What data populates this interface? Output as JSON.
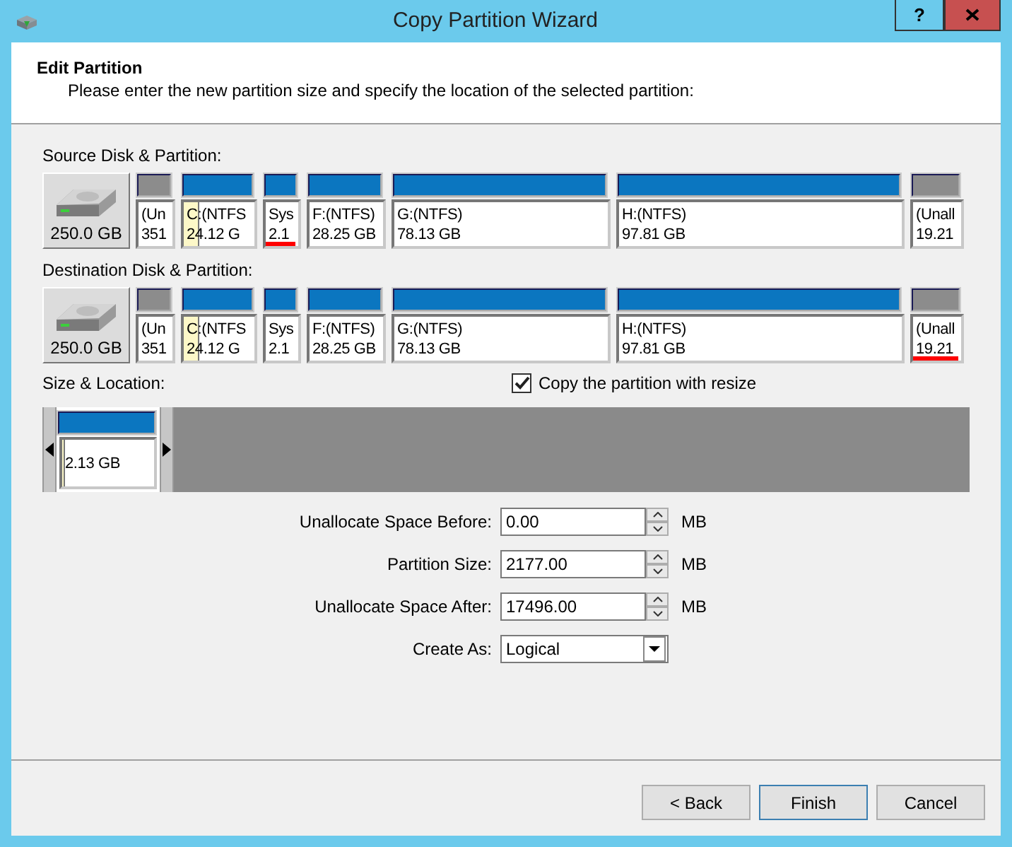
{
  "window": {
    "title": "Copy Partition Wizard",
    "help_button": "?"
  },
  "header": {
    "title": "Edit Partition",
    "description": "Please enter the new partition size and specify the location of the selected partition:"
  },
  "source": {
    "label": "Source Disk & Partition:",
    "disk_size": "250.0 GB",
    "partitions": [
      {
        "name": "(Un",
        "size": "351",
        "kind": "unallocated",
        "selected": false
      },
      {
        "name": "C:(NTFS",
        "size": "24.12 G",
        "kind": "primary",
        "level": 0.2,
        "selected": false
      },
      {
        "name": "Sys",
        "size": "2.1",
        "kind": "primary",
        "selected": true
      },
      {
        "name": "F:(NTFS)",
        "size": "28.25 GB",
        "kind": "primary",
        "selected": false
      },
      {
        "name": "G:(NTFS)",
        "size": "78.13 GB",
        "kind": "primary",
        "selected": false
      },
      {
        "name": "H:(NTFS)",
        "size": "97.81 GB",
        "kind": "primary",
        "selected": false
      },
      {
        "name": "(Unall",
        "size": "19.21",
        "kind": "unallocated",
        "selected": false
      }
    ]
  },
  "destination": {
    "label": "Destination Disk & Partition:",
    "disk_size": "250.0 GB",
    "partitions": [
      {
        "name": "(Un",
        "size": "351",
        "kind": "unallocated",
        "selected": false
      },
      {
        "name": "C:(NTFS",
        "size": "24.12 G",
        "kind": "primary",
        "level": 0.2,
        "selected": false
      },
      {
        "name": "Sys",
        "size": "2.1",
        "kind": "primary",
        "selected": false
      },
      {
        "name": "F:(NTFS)",
        "size": "28.25 GB",
        "kind": "primary",
        "selected": false
      },
      {
        "name": "G:(NTFS)",
        "size": "78.13 GB",
        "kind": "primary",
        "selected": false
      },
      {
        "name": "H:(NTFS)",
        "size": "97.81 GB",
        "kind": "primary",
        "selected": false
      },
      {
        "name": "(Unall",
        "size": "19.21",
        "kind": "unallocated",
        "selected": true
      }
    ]
  },
  "size_location": {
    "label": "Size & Location:",
    "copy_with_resize": {
      "label": "Copy the partition with resize",
      "checked": true
    },
    "partition": {
      "size": "2.13 GB",
      "level": 0.02
    }
  },
  "fields": [
    {
      "label": "Unallocate Space Before:",
      "value": "0.00",
      "unit": "MB",
      "kind": "spinner"
    },
    {
      "label": "Partition Size:",
      "value": "2177.00",
      "unit": "MB",
      "kind": "spinner"
    },
    {
      "label": "Unallocate Space After:",
      "value": "17496.00",
      "unit": "MB",
      "kind": "spinner"
    },
    {
      "label": "Create As:",
      "value": "Logical",
      "kind": "dropdown"
    }
  ],
  "buttons": [
    {
      "label": "< Back",
      "default": false
    },
    {
      "label": "Finish",
      "default": true
    },
    {
      "label": "Cancel",
      "default": false
    }
  ]
}
